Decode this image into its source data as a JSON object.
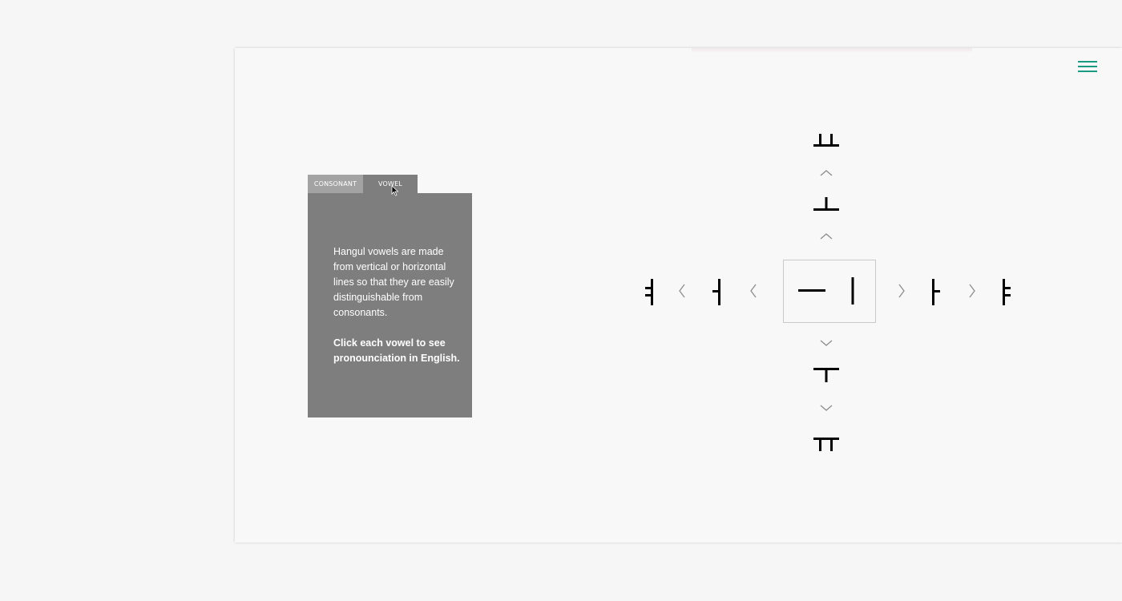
{
  "menu": {
    "icon": "hamburger-menu-icon",
    "color": "#1a9c84"
  },
  "tabs": [
    {
      "label": "CONSONANT",
      "active": false
    },
    {
      "label": "VOWEL",
      "active": true
    }
  ],
  "panel": {
    "description": "Hangul vowels are made from vertical or horizontal lines so that they are easily distinguishable from consonants.",
    "hint": "Click each vowel to see pronounciation in English."
  },
  "vowels": {
    "center": [
      "ㅡ",
      "ㅣ"
    ],
    "up": [
      "ㅗ",
      "ㅛ"
    ],
    "down": [
      "ㅜ",
      "ㅠ"
    ],
    "left": [
      "ㅓ",
      "ㅕ"
    ],
    "right": [
      "ㅏ",
      "ㅑ"
    ]
  },
  "arrows": [
    "chevron-up-icon",
    "chevron-down-icon",
    "chevron-left-icon",
    "chevron-right-icon"
  ]
}
